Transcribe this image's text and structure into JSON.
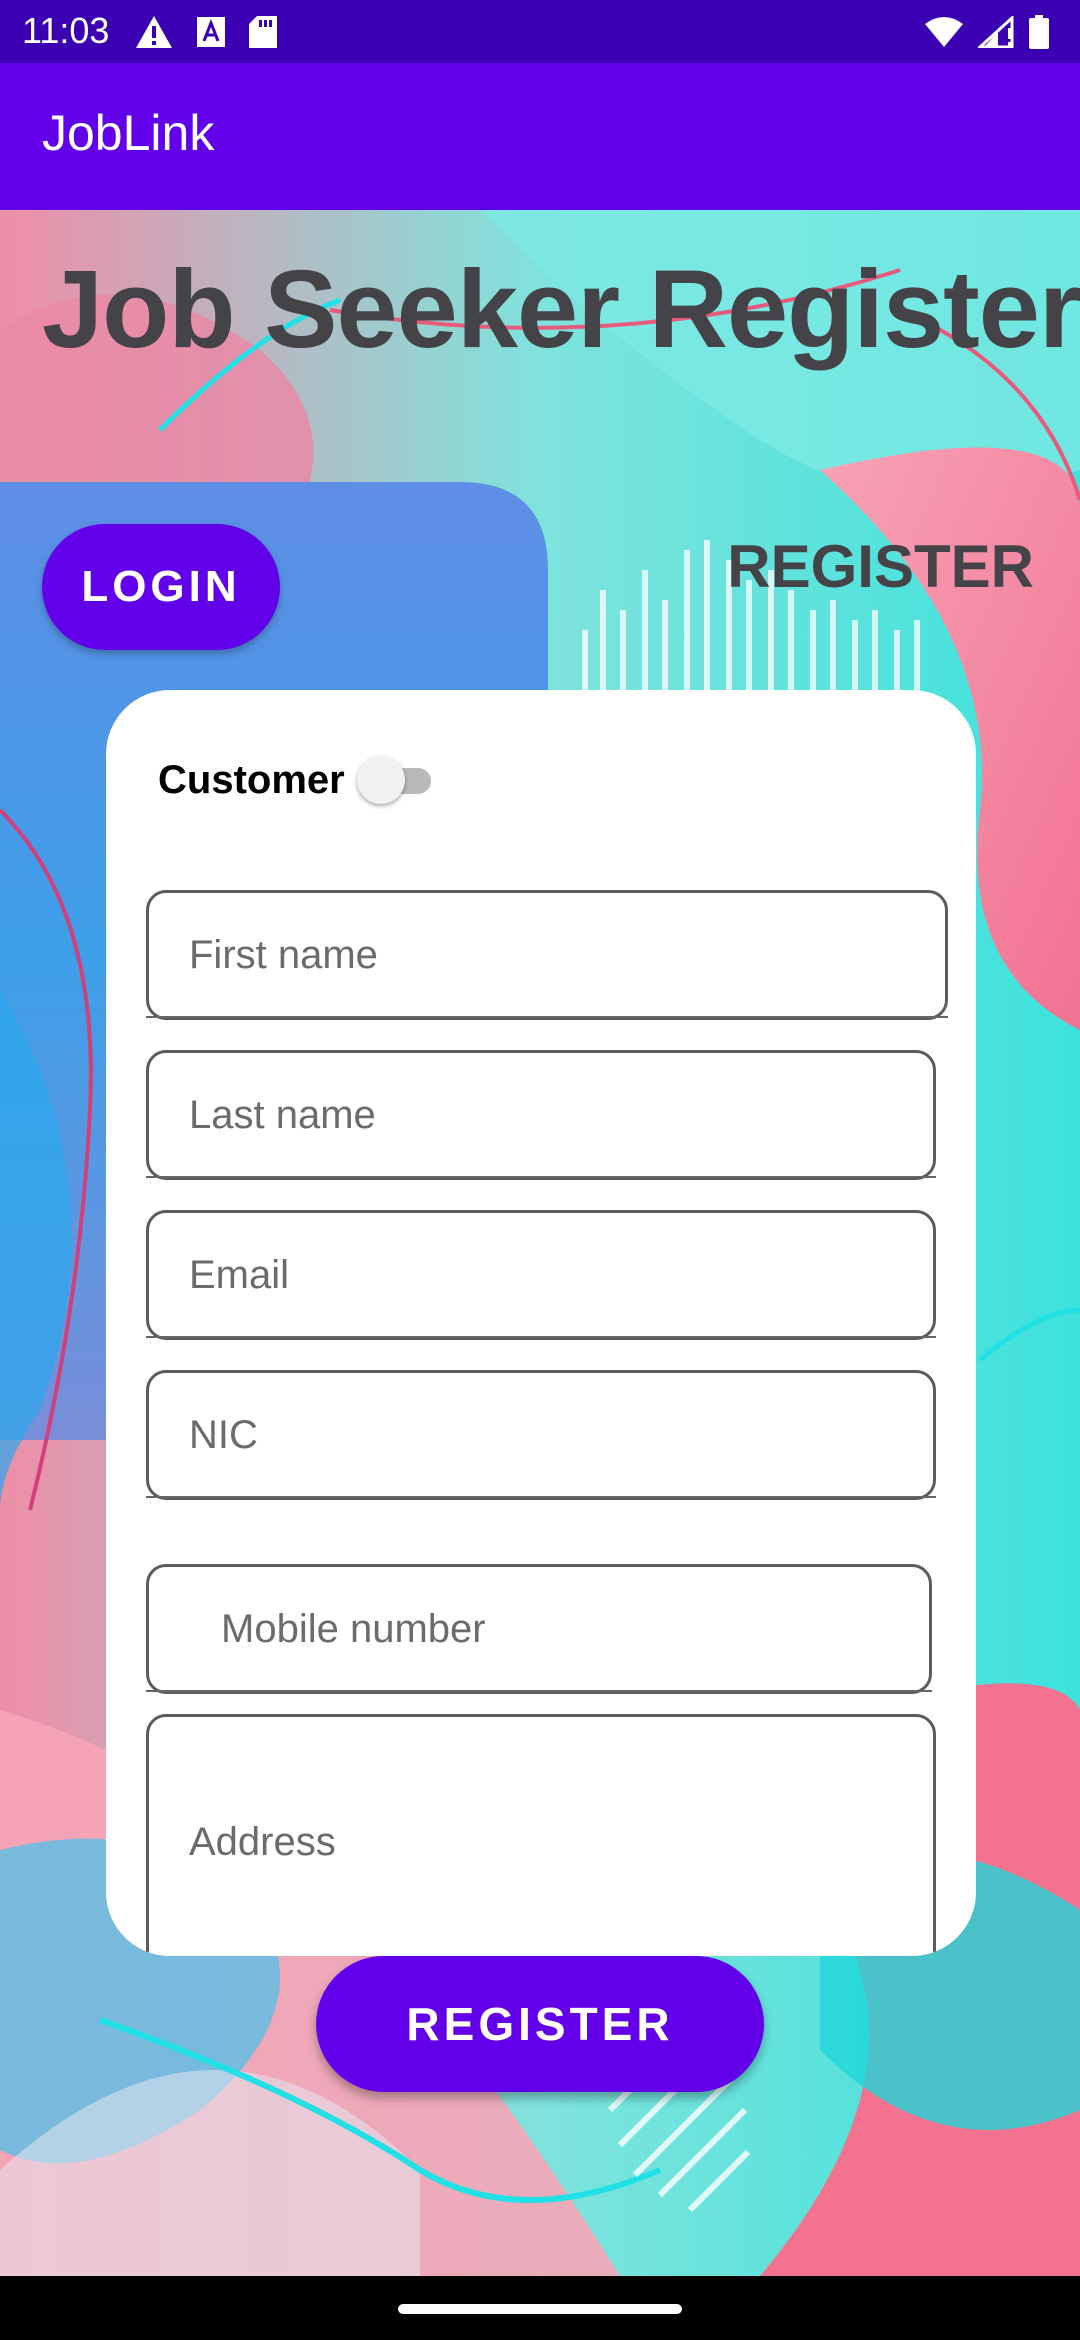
{
  "status_bar": {
    "time": "11:03",
    "left_icons": [
      "warning-icon",
      "font-a-icon",
      "sd-card-icon"
    ],
    "right_icons": [
      "wifi-icon",
      "signal-icon",
      "battery-icon"
    ]
  },
  "app_bar": {
    "title": "JobLink"
  },
  "page": {
    "title": "Job Seeker Register"
  },
  "tabs": {
    "login_label": "LOGIN",
    "register_label": "REGISTER"
  },
  "form": {
    "toggle_label": "Customer",
    "toggle_on": false,
    "fields": {
      "first_name": {
        "placeholder": "First name",
        "value": ""
      },
      "last_name": {
        "placeholder": "Last name",
        "value": ""
      },
      "email": {
        "placeholder": "Email",
        "value": ""
      },
      "nic": {
        "placeholder": "NIC",
        "value": ""
      },
      "mobile": {
        "placeholder": "Mobile number",
        "value": ""
      },
      "address": {
        "placeholder": "Address",
        "value": ""
      }
    }
  },
  "actions": {
    "register_label": "REGISTER"
  },
  "colors": {
    "primary": "#6200ea",
    "status_bar": "#3a00b2",
    "heading_text": "#444448"
  }
}
